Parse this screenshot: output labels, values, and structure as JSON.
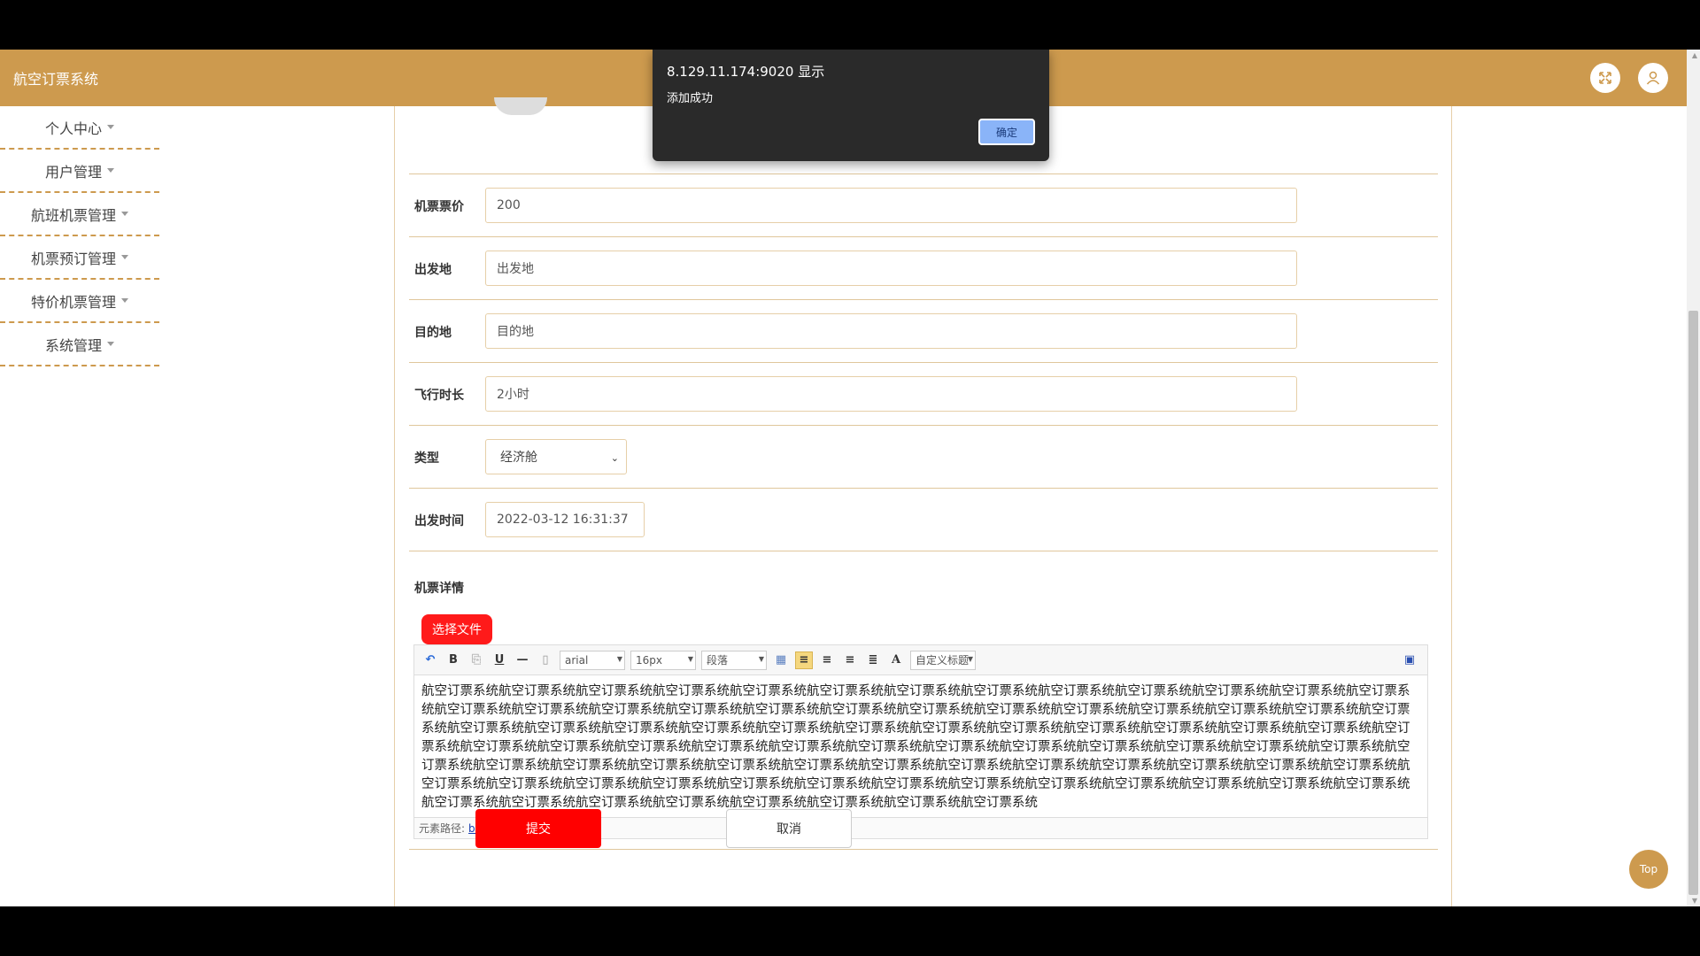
{
  "app": {
    "title": "航空订票系统"
  },
  "sidebar": {
    "items": [
      {
        "label": "个人中心"
      },
      {
        "label": "用户管理"
      },
      {
        "label": "航班机票管理"
      },
      {
        "label": "机票预订管理"
      },
      {
        "label": "特价机票管理"
      },
      {
        "label": "系统管理"
      }
    ]
  },
  "form": {
    "price": {
      "label": "机票票价",
      "value": "200"
    },
    "origin": {
      "label": "出发地",
      "value": "出发地"
    },
    "destination": {
      "label": "目的地",
      "value": "目的地"
    },
    "duration": {
      "label": "飞行时长",
      "value": "2小时"
    },
    "type": {
      "label": "类型",
      "value": "经济舱"
    },
    "depart_time": {
      "label": "出发时间",
      "value": "2022-03-12 16:31:37"
    },
    "details": {
      "label": "机票详情"
    },
    "file_button": "选择文件",
    "submit": "提交",
    "cancel": "取消"
  },
  "editor": {
    "font": "arial",
    "size": "16px",
    "paragraph": "段落",
    "custom_title": "自定义标题",
    "content": "航空订票系统航空订票系统航空订票系统航空订票系统航空订票系统航空订票系统航空订票系统航空订票系统航空订票系统航空订票系统航空订票系统航空订票系统航空订票系统航空订票系统航空订票系统航空订票系统航空订票系统航空订票系统航空订票系统航空订票系统航空订票系统航空订票系统航空订票系统航空订票系统航空订票系统航空订票系统航空订票系统航空订票系统航空订票系统航空订票系统航空订票系统航空订票系统航空订票系统航空订票系统航空订票系统航空订票系统航空订票系统航空订票系统航空订票系统航空订票系统航空订票系统航空订票系统航空订票系统航空订票系统航空订票系统航空订票系统航空订票系统航空订票系统航空订票系统航空订票系统航空订票系统航空订票系统航空订票系统航空订票系统航空订票系统航空订票系统航空订票系统航空订票系统航空订票系统航空订票系统航空订票系统航空订票系统航空订票系统航空订票系统航空订票系统航空订票系统航空订票系统航空订票系统航空订票系统航空订票系统航空订票系统航空订票系统航空订票系统航空订票系统航空订票系统航空订票系统航空订票系统航空订票系统航空订票系统航空订票系统航空订票系统航空订票系统航空订票系统航空订票系统航空订票系统",
    "path_label": "元素路径:",
    "path_body": "body",
    "path_sep": ">",
    "path_p": "p"
  },
  "dialog": {
    "title": "8.129.11.174:9020 显示",
    "message": "添加成功",
    "ok": "确定"
  },
  "top_button": "Top",
  "colors": {
    "accent": "#cd9a4e",
    "danger": "#ff0000"
  }
}
